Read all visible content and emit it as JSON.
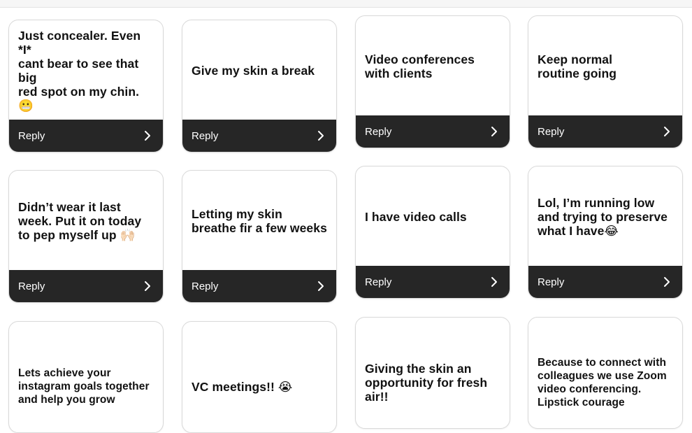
{
  "cards": [
    {
      "text": "Just concealer. Even *I*\ncant bear to see that big\nred spot on my chin.😬",
      "reply": "Reply"
    },
    {
      "text": "Give my skin a break",
      "reply": "Reply"
    },
    {
      "text": "Video conferences\nwith clients",
      "reply": "Reply"
    },
    {
      "text": "Keep normal\nroutine going",
      "reply": "Reply"
    },
    {
      "text": "Didn’t wear it last\nweek. Put it on today\nto pep myself up 🙌🏻",
      "reply": "Reply"
    },
    {
      "text": "Letting my skin\nbreathe fir a few weeks",
      "reply": "Reply"
    },
    {
      "text": "I have video calls",
      "reply": "Reply"
    },
    {
      "text": "Lol, I’m running low\nand trying to preserve\nwhat I have😂",
      "reply": "Reply"
    },
    {
      "text": "Lets achieve your\ninstagram goals together\nand help you grow"
    },
    {
      "text": "VC meetings!! 😭"
    },
    {
      "text": "Giving the skin an\nopportunity for fresh\nair!!"
    },
    {
      "text": "Because to connect with\ncolleagues we use Zoom\nvideo conferencing.\nLipstick courage"
    }
  ],
  "icons": {
    "reply_chevron": "chevron-right-icon"
  }
}
